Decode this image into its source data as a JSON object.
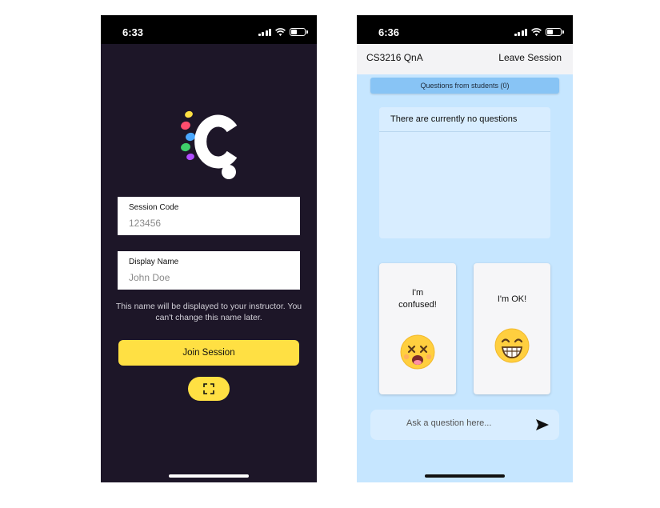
{
  "join_screen": {
    "status": {
      "time": "6:33"
    },
    "logo": {
      "name": "app-logo",
      "colors": [
        "#ffe043",
        "#ff4d6d",
        "#4aa8ff",
        "#3fcf6a",
        "#b04dff"
      ]
    },
    "session_code": {
      "label": "Session Code",
      "placeholder": "123456"
    },
    "display_name": {
      "label": "Display Name",
      "placeholder": "John Doe"
    },
    "helper_text": "This name will be displayed to your instructor. You can't change this name later.",
    "join_button": "Join Session",
    "scan_icon": "scan-icon",
    "accent": "#ffe043",
    "background": "#1d1628"
  },
  "session_screen": {
    "status": {
      "time": "6:36"
    },
    "header": {
      "title": "CS3216 QnA",
      "leave": "Leave Session"
    },
    "questions_tab": "Questions from students (0)",
    "empty_message": "There are currently no questions",
    "cards": [
      {
        "label": "I'm confused!",
        "icon": "confused-face-icon"
      },
      {
        "label": "I'm OK!",
        "icon": "grinning-face-icon"
      }
    ],
    "ask": {
      "placeholder": "Ask a question here..."
    },
    "send_icon": "send-icon",
    "background": "#c6e6ff"
  }
}
